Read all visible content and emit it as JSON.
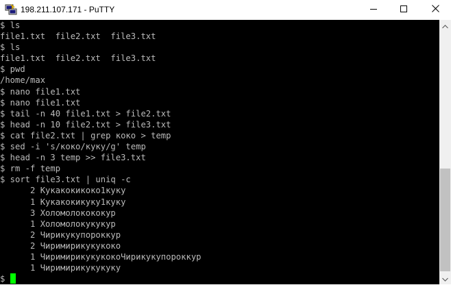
{
  "window": {
    "title": "198.211.107.171 - PuTTY",
    "app_icon": "putty-icon",
    "controls": {
      "minimize_icon": "minimize-icon",
      "maximize_icon": "maximize-icon",
      "close_icon": "close-icon"
    }
  },
  "terminal": {
    "lines": [
      "$ ls",
      "file1.txt  file2.txt  file3.txt",
      "$ ls",
      "file1.txt  file2.txt  file3.txt",
      "$ pwd",
      "/home/max",
      "$ nano file1.txt",
      "$ nano file1.txt",
      "$ tail -n 40 file1.txt > file2.txt",
      "$ head -n 10 file2.txt > file3.txt",
      "$ cat file2.txt | grep коко > temp",
      "$ sed -i 's/коко/куку/g' temp",
      "$ head -n 3 temp >> file3.txt",
      "$ rm -f temp",
      "$ sort file3.txt | uniq -c",
      "      2 Кукакокикоко1куку",
      "      1 Кукакокикуку1куку",
      "      3 Холомолокококур",
      "      1 Холомолокукукур",
      "      2 Чирикукупороккур",
      "      2 Чиримирикукукоко",
      "      1 ЧиримирикукукокоЧирикукупороккур",
      "      1 Чиримирикукукуку"
    ],
    "prompt": "$ ",
    "text_color": "#bbbbbb",
    "background_color": "#000000",
    "cursor_color": "#00ff00"
  },
  "scrollbar": {
    "up_icon": "scroll-up-arrow-icon",
    "down_icon": "scroll-down-arrow-icon"
  }
}
